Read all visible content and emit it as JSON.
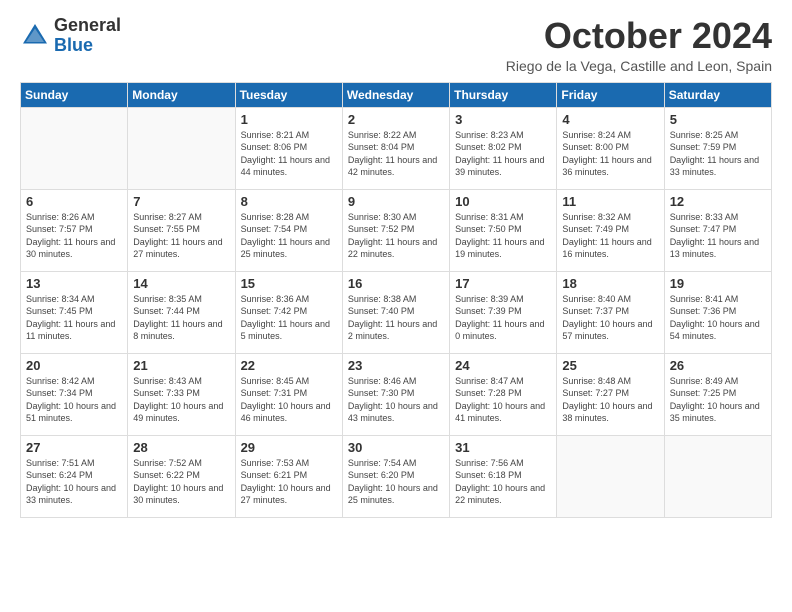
{
  "logo": {
    "general": "General",
    "blue": "Blue"
  },
  "title": "October 2024",
  "location": "Riego de la Vega, Castille and Leon, Spain",
  "days_of_week": [
    "Sunday",
    "Monday",
    "Tuesday",
    "Wednesday",
    "Thursday",
    "Friday",
    "Saturday"
  ],
  "weeks": [
    [
      {
        "day": "",
        "info": ""
      },
      {
        "day": "",
        "info": ""
      },
      {
        "day": "1",
        "info": "Sunrise: 8:21 AM\nSunset: 8:06 PM\nDaylight: 11 hours and 44 minutes."
      },
      {
        "day": "2",
        "info": "Sunrise: 8:22 AM\nSunset: 8:04 PM\nDaylight: 11 hours and 42 minutes."
      },
      {
        "day": "3",
        "info": "Sunrise: 8:23 AM\nSunset: 8:02 PM\nDaylight: 11 hours and 39 minutes."
      },
      {
        "day": "4",
        "info": "Sunrise: 8:24 AM\nSunset: 8:00 PM\nDaylight: 11 hours and 36 minutes."
      },
      {
        "day": "5",
        "info": "Sunrise: 8:25 AM\nSunset: 7:59 PM\nDaylight: 11 hours and 33 minutes."
      }
    ],
    [
      {
        "day": "6",
        "info": "Sunrise: 8:26 AM\nSunset: 7:57 PM\nDaylight: 11 hours and 30 minutes."
      },
      {
        "day": "7",
        "info": "Sunrise: 8:27 AM\nSunset: 7:55 PM\nDaylight: 11 hours and 27 minutes."
      },
      {
        "day": "8",
        "info": "Sunrise: 8:28 AM\nSunset: 7:54 PM\nDaylight: 11 hours and 25 minutes."
      },
      {
        "day": "9",
        "info": "Sunrise: 8:30 AM\nSunset: 7:52 PM\nDaylight: 11 hours and 22 minutes."
      },
      {
        "day": "10",
        "info": "Sunrise: 8:31 AM\nSunset: 7:50 PM\nDaylight: 11 hours and 19 minutes."
      },
      {
        "day": "11",
        "info": "Sunrise: 8:32 AM\nSunset: 7:49 PM\nDaylight: 11 hours and 16 minutes."
      },
      {
        "day": "12",
        "info": "Sunrise: 8:33 AM\nSunset: 7:47 PM\nDaylight: 11 hours and 13 minutes."
      }
    ],
    [
      {
        "day": "13",
        "info": "Sunrise: 8:34 AM\nSunset: 7:45 PM\nDaylight: 11 hours and 11 minutes."
      },
      {
        "day": "14",
        "info": "Sunrise: 8:35 AM\nSunset: 7:44 PM\nDaylight: 11 hours and 8 minutes."
      },
      {
        "day": "15",
        "info": "Sunrise: 8:36 AM\nSunset: 7:42 PM\nDaylight: 11 hours and 5 minutes."
      },
      {
        "day": "16",
        "info": "Sunrise: 8:38 AM\nSunset: 7:40 PM\nDaylight: 11 hours and 2 minutes."
      },
      {
        "day": "17",
        "info": "Sunrise: 8:39 AM\nSunset: 7:39 PM\nDaylight: 11 hours and 0 minutes."
      },
      {
        "day": "18",
        "info": "Sunrise: 8:40 AM\nSunset: 7:37 PM\nDaylight: 10 hours and 57 minutes."
      },
      {
        "day": "19",
        "info": "Sunrise: 8:41 AM\nSunset: 7:36 PM\nDaylight: 10 hours and 54 minutes."
      }
    ],
    [
      {
        "day": "20",
        "info": "Sunrise: 8:42 AM\nSunset: 7:34 PM\nDaylight: 10 hours and 51 minutes."
      },
      {
        "day": "21",
        "info": "Sunrise: 8:43 AM\nSunset: 7:33 PM\nDaylight: 10 hours and 49 minutes."
      },
      {
        "day": "22",
        "info": "Sunrise: 8:45 AM\nSunset: 7:31 PM\nDaylight: 10 hours and 46 minutes."
      },
      {
        "day": "23",
        "info": "Sunrise: 8:46 AM\nSunset: 7:30 PM\nDaylight: 10 hours and 43 minutes."
      },
      {
        "day": "24",
        "info": "Sunrise: 8:47 AM\nSunset: 7:28 PM\nDaylight: 10 hours and 41 minutes."
      },
      {
        "day": "25",
        "info": "Sunrise: 8:48 AM\nSunset: 7:27 PM\nDaylight: 10 hours and 38 minutes."
      },
      {
        "day": "26",
        "info": "Sunrise: 8:49 AM\nSunset: 7:25 PM\nDaylight: 10 hours and 35 minutes."
      }
    ],
    [
      {
        "day": "27",
        "info": "Sunrise: 7:51 AM\nSunset: 6:24 PM\nDaylight: 10 hours and 33 minutes."
      },
      {
        "day": "28",
        "info": "Sunrise: 7:52 AM\nSunset: 6:22 PM\nDaylight: 10 hours and 30 minutes."
      },
      {
        "day": "29",
        "info": "Sunrise: 7:53 AM\nSunset: 6:21 PM\nDaylight: 10 hours and 27 minutes."
      },
      {
        "day": "30",
        "info": "Sunrise: 7:54 AM\nSunset: 6:20 PM\nDaylight: 10 hours and 25 minutes."
      },
      {
        "day": "31",
        "info": "Sunrise: 7:56 AM\nSunset: 6:18 PM\nDaylight: 10 hours and 22 minutes."
      },
      {
        "day": "",
        "info": ""
      },
      {
        "day": "",
        "info": ""
      }
    ]
  ]
}
